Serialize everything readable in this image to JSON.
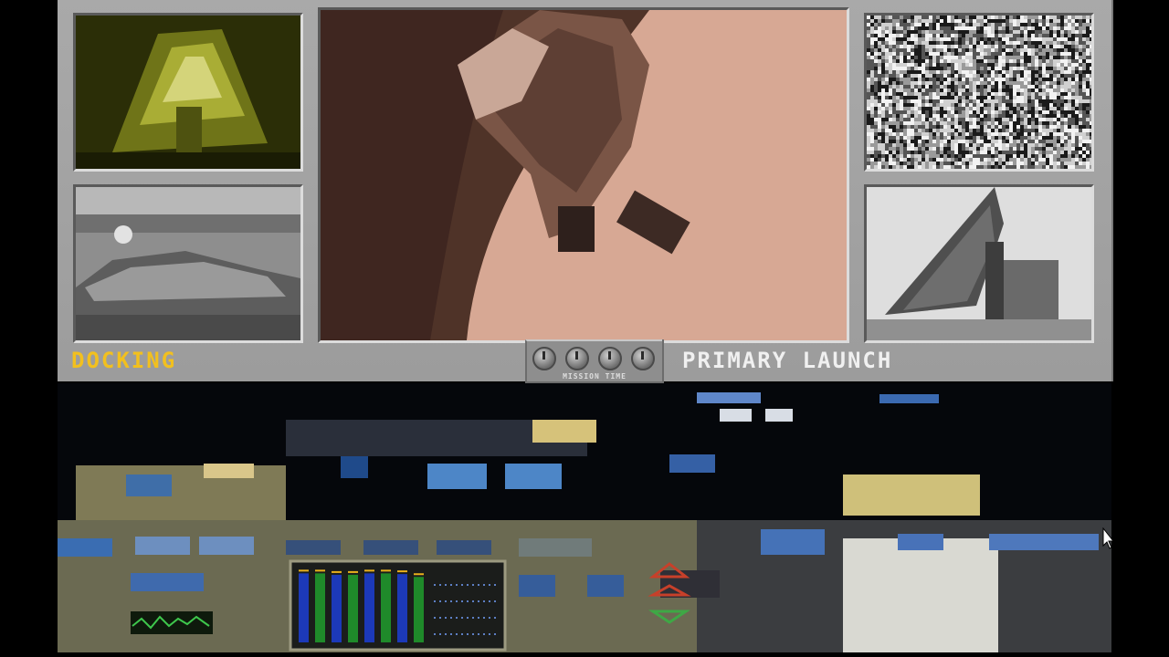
{
  "labels": {
    "left_caption": "DOCKING",
    "right_caption": "PRIMARY LAUNCH",
    "time_label": "MISSION TIME"
  },
  "colors": {
    "panel": "#a4a4a4",
    "left_caption": "#f2c01e",
    "right_caption": "#f0f0f0",
    "level_meter_blue": "#1c39b8",
    "level_meter_green": "#1f8a2a",
    "level_meter_peak": "#e8b01c"
  },
  "monitors": {
    "top_left": "yellow-tinted video feed",
    "bottom_left": "grayscale video feed",
    "main": "sepia video feed",
    "top_right": "static noise feed",
    "bottom_right": "grayscale video feed"
  },
  "time_dials": [
    {
      "icon": "dial-icon"
    },
    {
      "icon": "dial-icon"
    },
    {
      "icon": "dial-icon"
    },
    {
      "icon": "dial-icon"
    }
  ],
  "level_meter": {
    "levels": [
      0.97,
      0.97,
      0.95,
      0.95,
      0.97,
      0.97,
      0.96,
      0.92
    ],
    "colors": [
      "blue",
      "green",
      "blue",
      "green",
      "blue",
      "green",
      "blue",
      "green"
    ]
  }
}
